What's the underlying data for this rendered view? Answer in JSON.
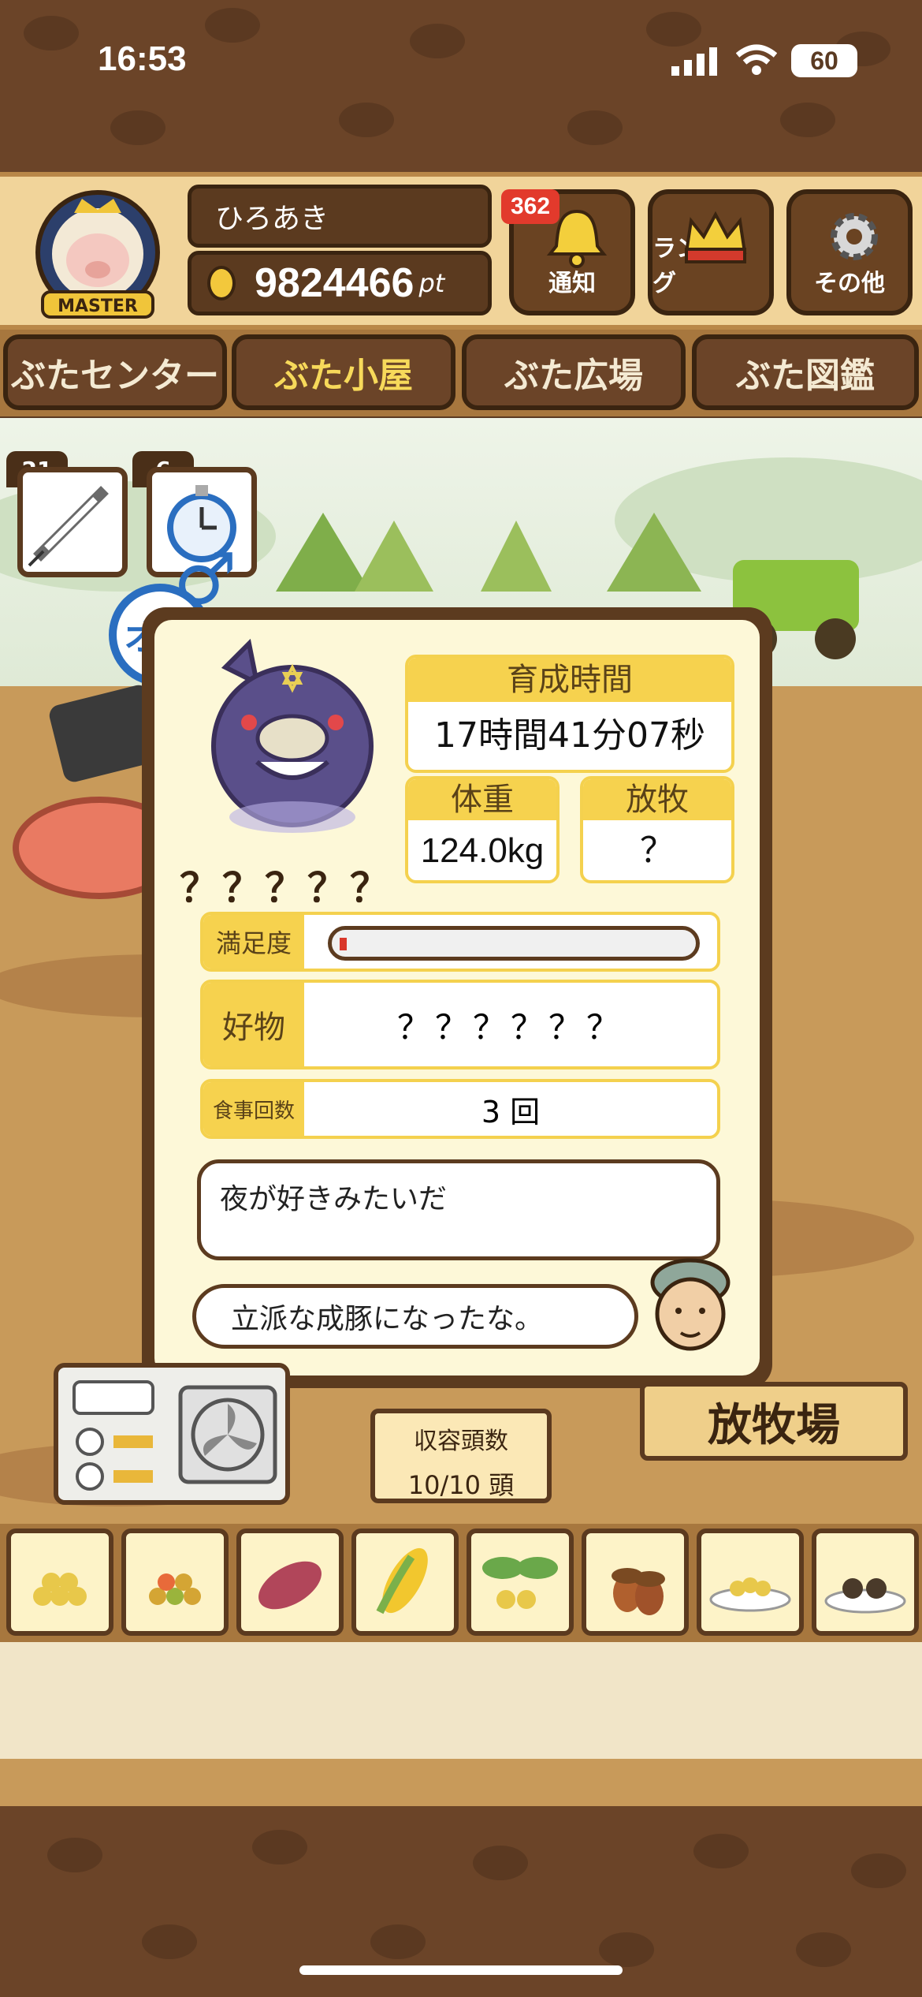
{
  "status_bar": {
    "time": "16:53",
    "battery": "60"
  },
  "user": {
    "name": "ひろあき",
    "points": "9824466",
    "points_unit": "pt",
    "rank_badge": "MASTER"
  },
  "header_buttons": [
    {
      "label": "通知",
      "badge": "362",
      "icon": "bell-icon"
    },
    {
      "label": "ランキング",
      "icon": "crown-icon"
    },
    {
      "label": "その他",
      "icon": "gear-icon"
    }
  ],
  "tabs": [
    {
      "label": "ぶたセンター"
    },
    {
      "label": "ぶた小屋",
      "active": true
    },
    {
      "label": "ぶた広場"
    },
    {
      "label": "ぶた図鑑"
    }
  ],
  "items": [
    {
      "count": "21",
      "icon": "syringe-icon"
    },
    {
      "count": "6",
      "icon": "stopwatch-icon"
    }
  ],
  "gender": {
    "label": "オス",
    "symbol": "♂"
  },
  "pig": {
    "name": "？？？？？",
    "growth_time_label": "育成時間",
    "growth_time": "17時間41分07秒",
    "weight_label": "体重",
    "weight": "124.0kg",
    "graze_label": "放牧",
    "graze": "？",
    "satisfaction_label": "満足度",
    "satisfaction": 0.02,
    "favorite_label": "好物",
    "favorite": "？？？？？？",
    "meals_label": "食事回数",
    "meals": "3 回",
    "hint": "夜が好きみたいだ",
    "comment": "立派な成豚になったな。"
  },
  "capacity": {
    "label": "収容頭数",
    "value": "10/10 頭"
  },
  "pasture_sign": "放牧場",
  "foods": [
    {
      "icon": "grain-pile-icon"
    },
    {
      "icon": "mixed-grain-icon"
    },
    {
      "icon": "sweet-potato-icon"
    },
    {
      "icon": "corn-icon"
    },
    {
      "icon": "beans-icon"
    },
    {
      "icon": "acorn-icon"
    },
    {
      "icon": "soybean-plate-icon"
    },
    {
      "icon": "truffle-plate-icon"
    }
  ],
  "colors": {
    "accent_yellow": "#f6d24e",
    "wood_dark": "#5b3a1f",
    "panel_bg": "#fdf8d8",
    "male_blue": "#2a6ec0"
  }
}
